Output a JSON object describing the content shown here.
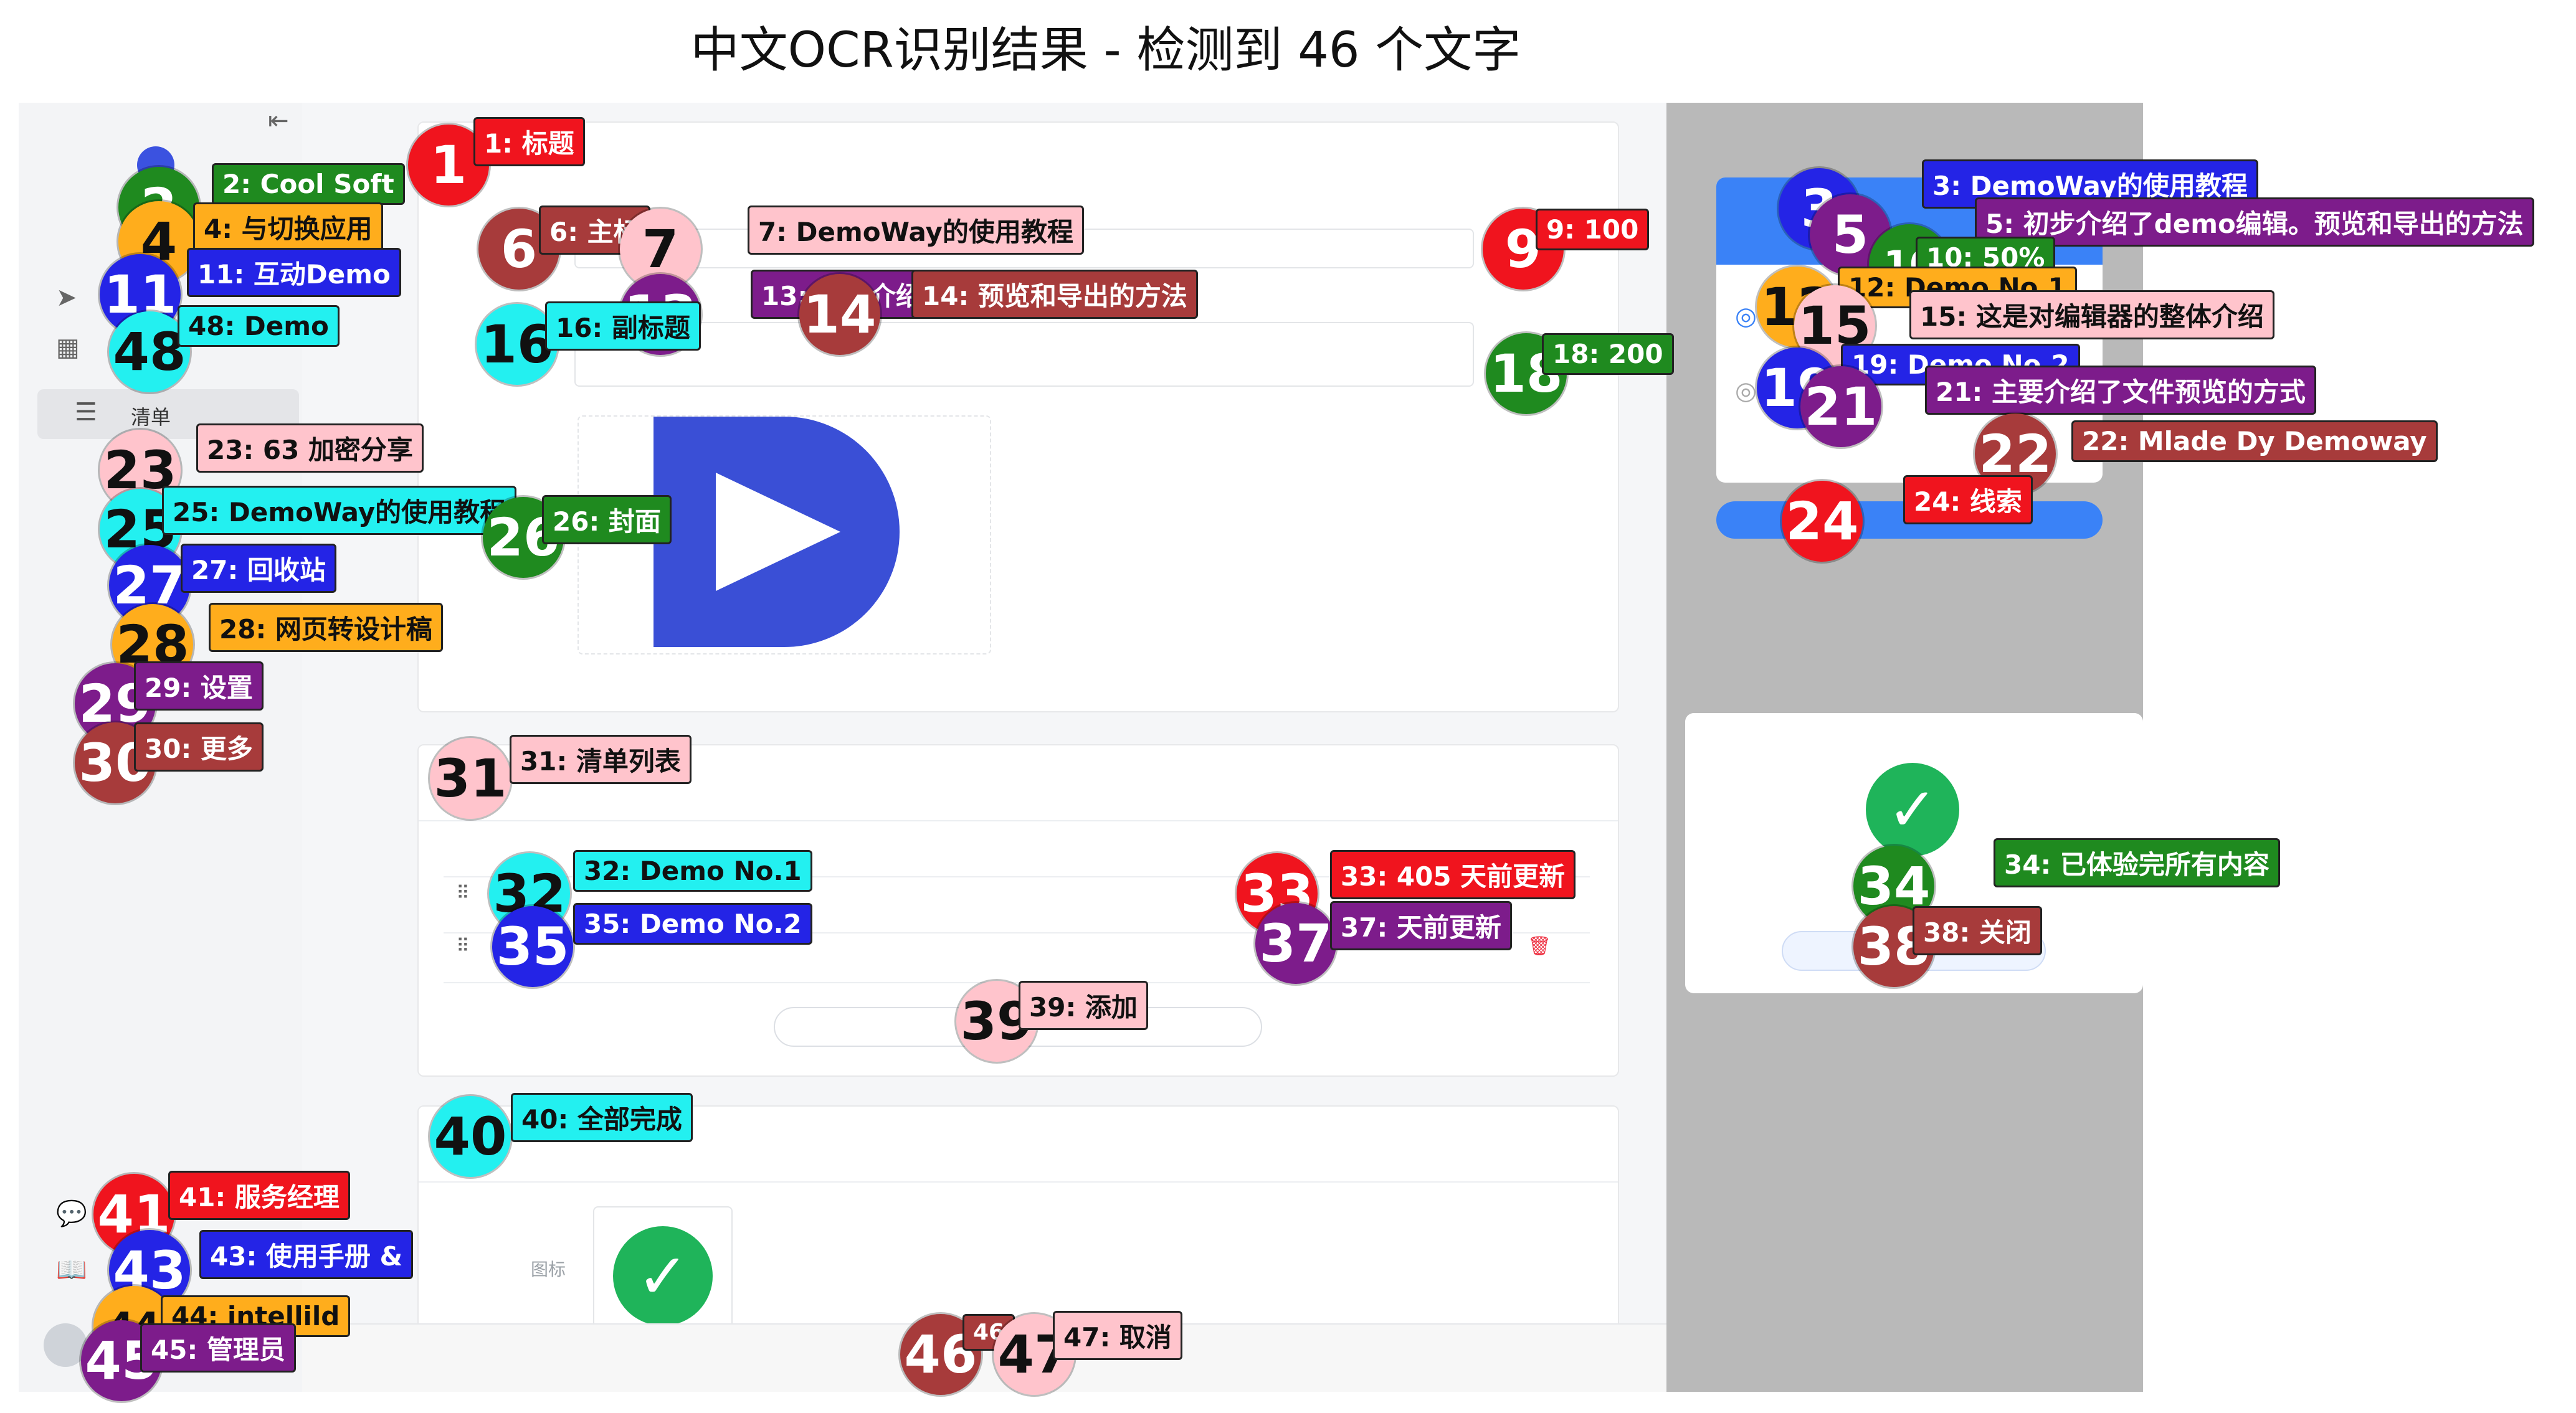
{
  "title": "中文OCR识别结果 - 检测到 46 个文字",
  "sidebar": {
    "menu_label": "清单"
  },
  "main": {
    "panel_label": "图标",
    "toolbar_value": "100"
  },
  "preview": {
    "check_color": "#1fb45a"
  },
  "ocr": [
    {
      "n": "1",
      "label": "1: 标题",
      "color": "red"
    },
    {
      "n": "2",
      "label": "2: Cool Soft",
      "color": "green"
    },
    {
      "n": "3",
      "label": "3: DemoWay的使用教程",
      "color": "blue"
    },
    {
      "n": "4",
      "label": "4: 与切换应用",
      "color": "orange"
    },
    {
      "n": "5",
      "label": "5: 初步介绍了demo编辑。预览和导出的方法",
      "color": "purple"
    },
    {
      "n": "6",
      "label": "6: 主标",
      "color": "brown"
    },
    {
      "n": "7",
      "label": "7: DemoWay的使用教程",
      "color": "pink"
    },
    {
      "n": "9",
      "label": "9: 100",
      "color": "red"
    },
    {
      "n": "10",
      "label": "10: 50%",
      "color": "green"
    },
    {
      "n": "11",
      "label": "11: 互动Demo",
      "color": "blue"
    },
    {
      "n": "12",
      "label": "12: Demo No.1",
      "color": "orange"
    },
    {
      "n": "13",
      "label": "13: 初步介绍",
      "color": "purple"
    },
    {
      "n": "14",
      "label": "14: 预览和导出的方法",
      "color": "brown"
    },
    {
      "n": "15",
      "label": "15: 这是对编辑器的整体介绍",
      "color": "pink"
    },
    {
      "n": "16",
      "label": "16: 副标题",
      "color": "cyan"
    },
    {
      "n": "18",
      "label": "18: 200",
      "color": "green"
    },
    {
      "n": "19",
      "label": "19: Demo No.2",
      "color": "blue"
    },
    {
      "n": "21",
      "label": "21: 主要介绍了文件预览的方式",
      "color": "purple"
    },
    {
      "n": "22",
      "label": "22: Mlade Dy Demoway",
      "color": "brown"
    },
    {
      "n": "23",
      "label": "23: 63 加密分享",
      "color": "pink"
    },
    {
      "n": "24",
      "label": "24: 线索",
      "color": "cyan"
    },
    {
      "n": "25",
      "label": "25: DemoWay的使用教程",
      "color": "red"
    },
    {
      "n": "26",
      "label": "26: 封面",
      "color": "green"
    },
    {
      "n": "27",
      "label": "27: 回收站",
      "color": "blue"
    },
    {
      "n": "28",
      "label": "28: 网页转设计稿",
      "color": "orange"
    },
    {
      "n": "29",
      "label": "29: 设置",
      "color": "purple"
    },
    {
      "n": "30",
      "label": "30: 更多",
      "color": "brown"
    },
    {
      "n": "31",
      "label": "31: 清单列表",
      "color": "pink"
    },
    {
      "n": "32",
      "label": "32: Demo No.1",
      "color": "cyan"
    },
    {
      "n": "33",
      "label": "33: 405 天前更新",
      "color": "red"
    },
    {
      "n": "34",
      "label": "34: 已体验完所有内容",
      "color": "green"
    },
    {
      "n": "35",
      "label": "35: Demo No.2",
      "color": "blue"
    },
    {
      "n": "37",
      "label": "37: 天前更新",
      "color": "purple"
    },
    {
      "n": "38",
      "label": "38: 关闭",
      "color": "brown"
    },
    {
      "n": "39",
      "label": "39: 添加",
      "color": "pink"
    },
    {
      "n": "40",
      "label": "40: 全部完成",
      "color": "cyan"
    },
    {
      "n": "41",
      "label": "41: 服务经理",
      "color": "red"
    },
    {
      "n": "43",
      "label": "43: 使用手册 &",
      "color": "blue"
    },
    {
      "n": "44",
      "label": "44: intellild",
      "color": "orange"
    },
    {
      "n": "45",
      "label": "45: 管理员",
      "color": "purple"
    },
    {
      "n": "46",
      "label": "46",
      "color": "brown"
    },
    {
      "n": "47",
      "label": "47: 取消",
      "color": "pink"
    },
    {
      "n": "48",
      "label": "48: Demo",
      "color": "cyan"
    }
  ]
}
